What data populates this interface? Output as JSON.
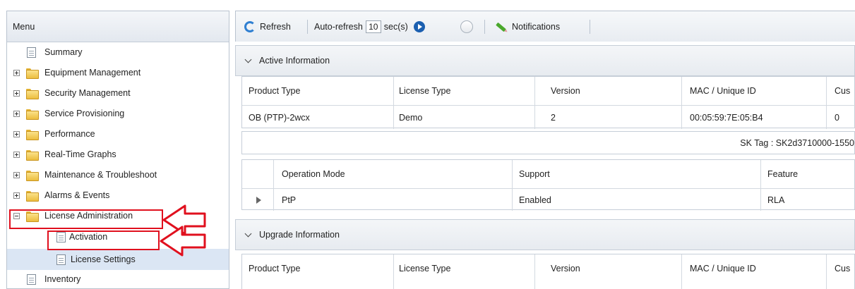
{
  "menu": {
    "title": "Menu",
    "items": [
      {
        "label": "Summary"
      },
      {
        "label": "Equipment Management"
      },
      {
        "label": "Security Management"
      },
      {
        "label": "Service Provisioning"
      },
      {
        "label": "Performance"
      },
      {
        "label": "Real-Time Graphs"
      },
      {
        "label": "Maintenance & Troubleshoot"
      },
      {
        "label": "Alarms & Events"
      },
      {
        "label": "License Administration"
      },
      {
        "label": "Activation"
      },
      {
        "label": "License Settings"
      },
      {
        "label": "Inventory"
      }
    ]
  },
  "toolbar": {
    "refresh_label": "Refresh",
    "auto_refresh_label": "Auto-refresh",
    "interval_value": "10",
    "interval_unit": "sec(s)",
    "notifications_label": "Notifications"
  },
  "active": {
    "title": "Active Information",
    "columns": [
      "Product Type",
      "License Type",
      "Version",
      "MAC / Unique ID",
      "Cus"
    ],
    "row": [
      "OB (PTP)-2wcx",
      "Demo",
      "2",
      "00:05:59:7E:05:B4",
      "0"
    ],
    "sk_tag": "SK Tag : SK2d3710000-1550",
    "features": {
      "columns": [
        "Operation Mode",
        "Support",
        "Feature"
      ],
      "row": [
        "PtP",
        "Enabled",
        "RLA"
      ]
    }
  },
  "upgrade": {
    "title": "Upgrade Information",
    "columns": [
      "Product Type",
      "License Type",
      "Version",
      "MAC / Unique ID",
      "Cus"
    ]
  },
  "colors": {
    "highlight": "#e0101e",
    "selected_row": "#dbe6f4",
    "accent": "#1b5fb0"
  }
}
